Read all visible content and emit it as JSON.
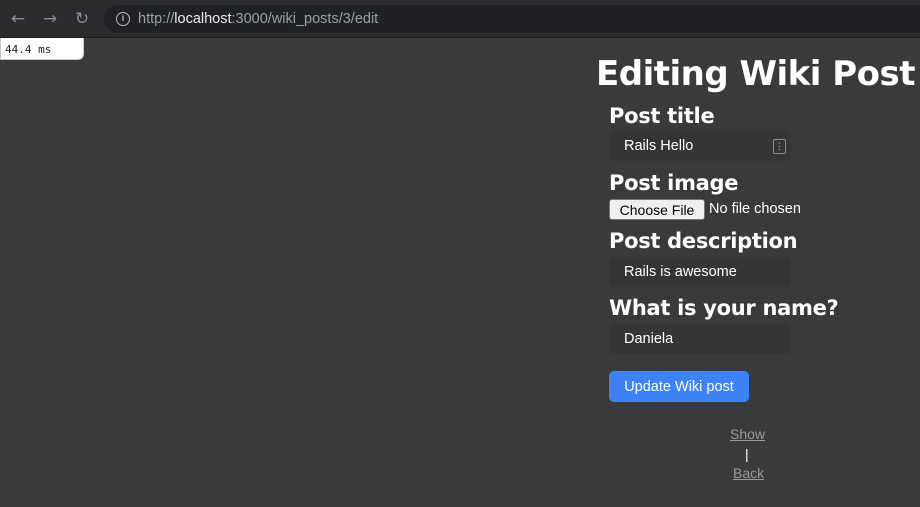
{
  "browser": {
    "back_icon": "←",
    "forward_icon": "→",
    "reload_icon": "↻",
    "info_icon": "i",
    "url_scheme": "http://",
    "url_host": "localhost",
    "url_rest": ":3000/wiki_posts/3/edit"
  },
  "timing": {
    "value": "44.4 ms"
  },
  "form": {
    "heading": "Editing Wiki Post",
    "title_label": "Post title",
    "title_value": "Rails Hello",
    "key_icon": "⋮",
    "image_label": "Post image",
    "file_button_label": "Choose File",
    "file_status": "No file chosen",
    "description_label": "Post description",
    "description_value": "Rails is awesome",
    "name_label": "What is your name?",
    "name_value": "Daniela",
    "submit_label": "Update Wiki post"
  },
  "links": {
    "show": "Show",
    "separator": "|",
    "back": "Back"
  },
  "colors": {
    "page_background": "#3a3a3a",
    "field_background": "#353535",
    "submit_background": "#3e82f7",
    "link_color": "#9a9a9a"
  }
}
